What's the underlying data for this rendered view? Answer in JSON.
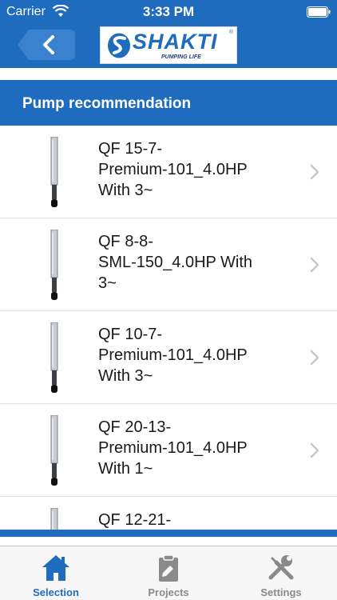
{
  "status_bar": {
    "carrier": "Carrier",
    "time": "3:33 PM"
  },
  "header": {
    "back_icon": "chevron-left-icon",
    "logo": {
      "brand": "SHAKTI",
      "tagline": "PUMPING LIFE",
      "registered": "®"
    }
  },
  "section": {
    "title": "Pump recommendation"
  },
  "pumps": [
    {
      "name": "QF 15-7-\nPremium-101_4.0HP\nWith 3~"
    },
    {
      "name": "QF 8-8-\nSML-150_4.0HP With\n3~"
    },
    {
      "name": "QF 10-7-\nPremium-101_4.0HP\nWith 3~"
    },
    {
      "name": "QF 20-13-\nPremium-101_4.0HP\nWith 1~"
    },
    {
      "name": "QF 12-21-"
    }
  ],
  "tabbar": {
    "tabs": [
      {
        "label": "Selection",
        "icon": "home-icon",
        "active": true
      },
      {
        "label": "Projects",
        "icon": "clipboard-icon",
        "active": false
      },
      {
        "label": "Settings",
        "icon": "tools-icon",
        "active": false
      }
    ]
  },
  "colors": {
    "primary": "#1f6cbf",
    "tab_inactive": "#8a8a8a"
  }
}
